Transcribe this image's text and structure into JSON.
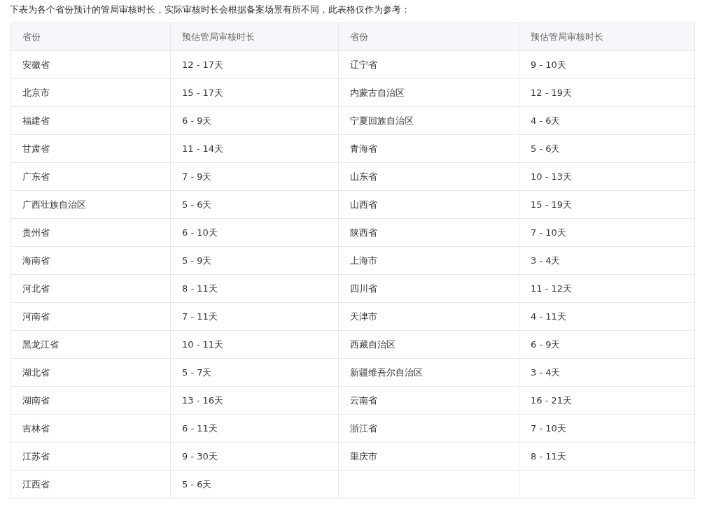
{
  "intro": "下表为各个省份预计的管局审核时长，实际审核时长会根据备案场景有所不同，此表格仅作为参考：",
  "table": {
    "columns": [
      "省份",
      "预估管局审核时长",
      "省份",
      "预估管局审核时长"
    ],
    "rows": [
      [
        "安徽省",
        "12 - 17天",
        "辽宁省",
        "9 - 10天"
      ],
      [
        "北京市",
        "15 - 17天",
        "内蒙古自治区",
        "12 - 19天"
      ],
      [
        "福建省",
        "6 - 9天",
        "宁夏回族自治区",
        "4 - 6天"
      ],
      [
        "甘肃省",
        "11 - 14天",
        "青海省",
        "5 - 6天"
      ],
      [
        "广东省",
        "7 - 9天",
        "山东省",
        "10 - 13天"
      ],
      [
        "广西壮族自治区",
        "5 - 6天",
        "山西省",
        "15 - 19天"
      ],
      [
        "贵州省",
        "6 - 10天",
        "陕西省",
        "7 - 10天"
      ],
      [
        "海南省",
        "5 - 9天",
        "上海市",
        "3 - 4天"
      ],
      [
        "河北省",
        "8 - 11天",
        "四川省",
        "11 - 12天"
      ],
      [
        "河南省",
        "7 - 11天",
        "天津市",
        "4 - 11天"
      ],
      [
        "黑龙江省",
        "10 - 11天",
        "西藏自治区",
        "6 - 9天"
      ],
      [
        "湖北省",
        "5 - 7天",
        "新疆维吾尔自治区",
        "3 - 4天"
      ],
      [
        "湖南省",
        "13 - 16天",
        "云南省",
        "16 - 21天"
      ],
      [
        "吉林省",
        "6 - 11天",
        "浙江省",
        "7 - 10天"
      ],
      [
        "江苏省",
        "9 - 30天",
        "重庆市",
        "8 - 11天"
      ],
      [
        "江西省",
        "5 - 6天"
      ]
    ]
  }
}
